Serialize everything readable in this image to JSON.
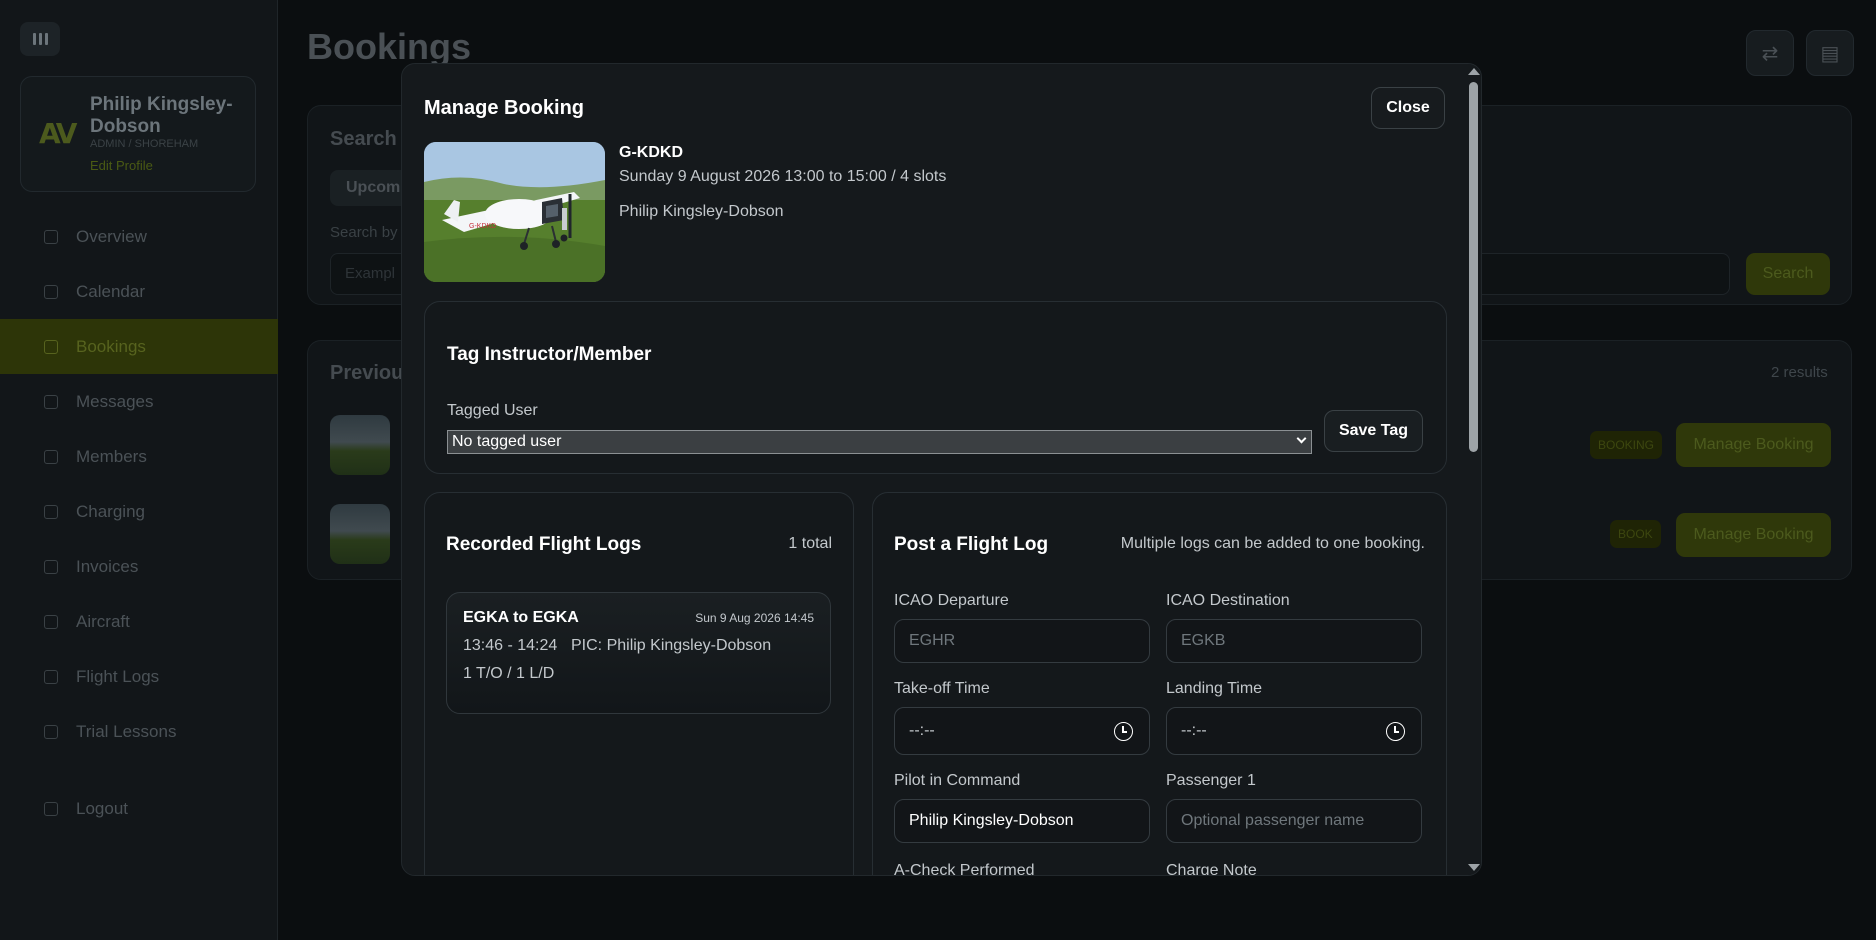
{
  "background": {
    "page_title": "Bookings",
    "sidebar": {
      "profile": {
        "name": "Philip Kingsley-Dobson",
        "role": "ADMIN / SHOREHAM",
        "edit_label": "Edit Profile"
      },
      "items": [
        {
          "label": "Overview",
          "icon": "home-icon"
        },
        {
          "label": "Calendar",
          "icon": "calendar-icon"
        },
        {
          "label": "Bookings",
          "icon": "bookings-icon",
          "active": true
        },
        {
          "label": "Messages",
          "icon": "messages-icon"
        },
        {
          "label": "Members",
          "icon": "members-icon"
        },
        {
          "label": "Charging",
          "icon": "charging-icon"
        },
        {
          "label": "Invoices",
          "icon": "invoices-icon"
        },
        {
          "label": "Aircraft",
          "icon": "aircraft-icon"
        },
        {
          "label": "Flight Logs",
          "icon": "flight-logs-icon"
        },
        {
          "label": "Trial Lessons",
          "icon": "trial-lessons-icon"
        }
      ],
      "logout_label": "Logout"
    },
    "search_heading": "Search I",
    "upcoming_chip": "Upcomi",
    "search_by_label": "Search by",
    "search_placeholder": "Exampl",
    "search_button": "Search",
    "previous_heading": "Previou",
    "results_count": "2 results",
    "rows": [
      {
        "badge": "BOOKING",
        "manage_label": "Manage Booking"
      },
      {
        "badge": "BOOK",
        "manage_label": "Manage Booking"
      }
    ]
  },
  "modal": {
    "title": "Manage Booking",
    "close_label": "Close",
    "aircraft_registration": "G-KDKD",
    "booking_when": "Sunday 9 August 2026 13:00 to 15:00 / 4 slots",
    "booking_who": "Philip Kingsley-Dobson",
    "tag": {
      "title": "Tag Instructor/Member",
      "field_label": "Tagged User",
      "selected": "No tagged user",
      "save_label": "Save Tag"
    },
    "logs": {
      "title": "Recorded Flight Logs",
      "count": "1 total",
      "entries": [
        {
          "route": "EGKA to EGKA",
          "date": "Sun 9 Aug 2026 14:45",
          "times": "13:46 - 14:24",
          "pic": "PIC: Philip Kingsley-Dobson",
          "counts": "1 T/O / 1 L/D"
        }
      ]
    },
    "post": {
      "title": "Post a Flight Log",
      "note": "Multiple logs can be added to one booking.",
      "icao_departure_label": "ICAO Departure",
      "icao_departure_placeholder": "EGHR",
      "icao_destination_label": "ICAO Destination",
      "icao_destination_placeholder": "EGKB",
      "takeoff_label": "Take-off Time",
      "takeoff_value": "--:--",
      "landing_label": "Landing Time",
      "landing_value": "--:--",
      "pic_label": "Pilot in Command",
      "pic_value": "Philip Kingsley-Dobson",
      "passenger_label": "Passenger 1",
      "passenger_placeholder": "Optional passenger name",
      "acheck_label": "A-Check Performed",
      "charge_note_label": "Charge Note"
    }
  }
}
